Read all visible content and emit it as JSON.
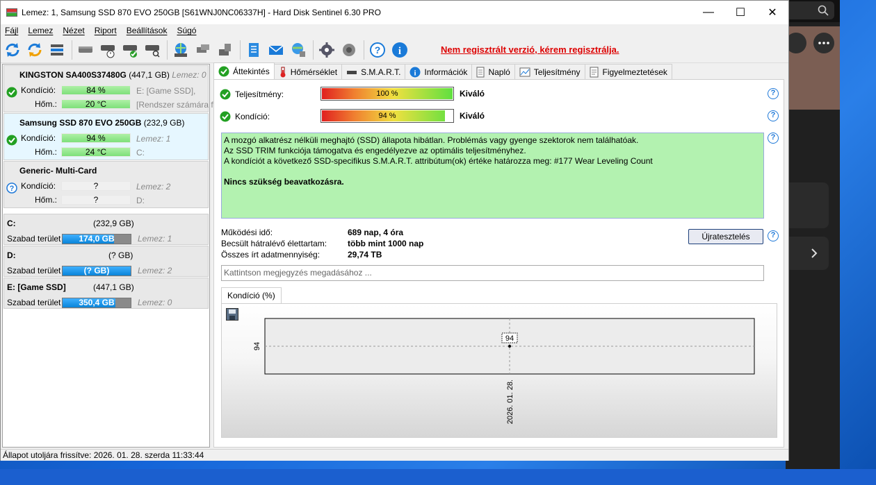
{
  "window": {
    "title": "Lemez: 1, Samsung SSD 870 EVO 250GB [S61WNJ0NC06337H]  -  Hard Disk Sentinel 6.30 PRO",
    "minimize": "—",
    "maximize": "☐",
    "close": "✕"
  },
  "menu": [
    "Fájl",
    "Lemez",
    "Nézet",
    "Riport",
    "Beállítások",
    "Súgó"
  ],
  "toolbar": {
    "unregistered": "Nem regisztrált verzió, kérem regisztrálja."
  },
  "disks": [
    {
      "name": "KINGSTON SA400S37480G",
      "size": "(447,1 GB)",
      "disk_no": "Lemez: 0",
      "condition_label": "Kondíció:",
      "condition": "84 %",
      "temp_label": "Hőm.:",
      "temp": "20 °C",
      "side1": "E: [Game SSD],",
      "side2": "[Rendszer számára f"
    },
    {
      "name": "Samsung SSD 870 EVO 250GB",
      "size": "(232,9 GB)",
      "disk_no": "",
      "condition_label": "Kondíció:",
      "condition": "94 %",
      "temp_label": "Hőm.:",
      "temp": "24 °C",
      "side1": "Lemez: 1",
      "side2": "C:"
    },
    {
      "name": "Generic- Multi-Card",
      "size": "",
      "disk_no": "",
      "condition_label": "Kondíció:",
      "condition": "?",
      "temp_label": "Hőm.:",
      "temp": "?",
      "side1": "Lemez: 2",
      "side2": "D:"
    }
  ],
  "volumes": [
    {
      "name": "C:",
      "size": "(232,9 GB)",
      "free_label": "Szabad terület",
      "free": "174,0 GB",
      "free_fraction": 0.75,
      "disk": "Lemez: 1"
    },
    {
      "name": "D:",
      "size": "(? GB)",
      "free_label": "Szabad terület",
      "free": "(? GB)",
      "free_fraction": 1.0,
      "disk": "Lemez: 2"
    },
    {
      "name": "E: [Game SSD]",
      "size": "(447,1 GB)",
      "free_label": "Szabad terület",
      "free": "350,4 GB",
      "free_fraction": 0.78,
      "disk": "Lemez: 0"
    }
  ],
  "tabs": [
    "Áttekintés",
    "Hőmérséklet",
    "S.M.A.R.T.",
    "Információk",
    "Napló",
    "Teljesítmény",
    "Figyelmeztetések"
  ],
  "overview": {
    "performance_label": "Teljesítmény:",
    "performance": "100 %",
    "performance_fraction": 1.0,
    "performance_rating": "Kiváló",
    "condition_label": "Kondíció:",
    "condition": "94 %",
    "condition_fraction": 0.94,
    "condition_rating": "Kiváló",
    "message_lines": [
      "A mozgó alkatrész nélküli meghajtó (SSD) állapota hibátlan. Problémás vagy gyenge szektorok nem találhatóak.",
      "Az SSD TRIM funkciója támogatva és engedélyezve az optimális teljesítményhez.",
      "A kondíciót a következő SSD-specifikus S.M.A.R.T. attribútum(ok) értéke határozza meg:  #177 Wear Leveling Count"
    ],
    "message_strong": "Nincs szükség beavatkozásra.",
    "uptime_label": "Működési idő:",
    "uptime": "689 nap, 4 óra",
    "lifetime_label": "Becsült hátralévő élettartam:",
    "lifetime": "több mint 1000 nap",
    "written_label": "Összes írt adatmennyiség:",
    "written": "29,74 TB",
    "retest_button": "Újratesztelés",
    "note_placeholder": "Kattintson megjegyzés megadásához ...",
    "chart_tab": "Kondíció  (%)"
  },
  "chart_data": {
    "type": "line",
    "x": [
      "2026. 01. 28."
    ],
    "series": [
      {
        "values": [
          94
        ]
      }
    ],
    "y_tick_labels": [
      "94"
    ],
    "data_labels": [
      "94"
    ],
    "grid": false
  },
  "status": "Állapot utoljára frissítve: 2026. 01. 28. szerda 11:33:44"
}
